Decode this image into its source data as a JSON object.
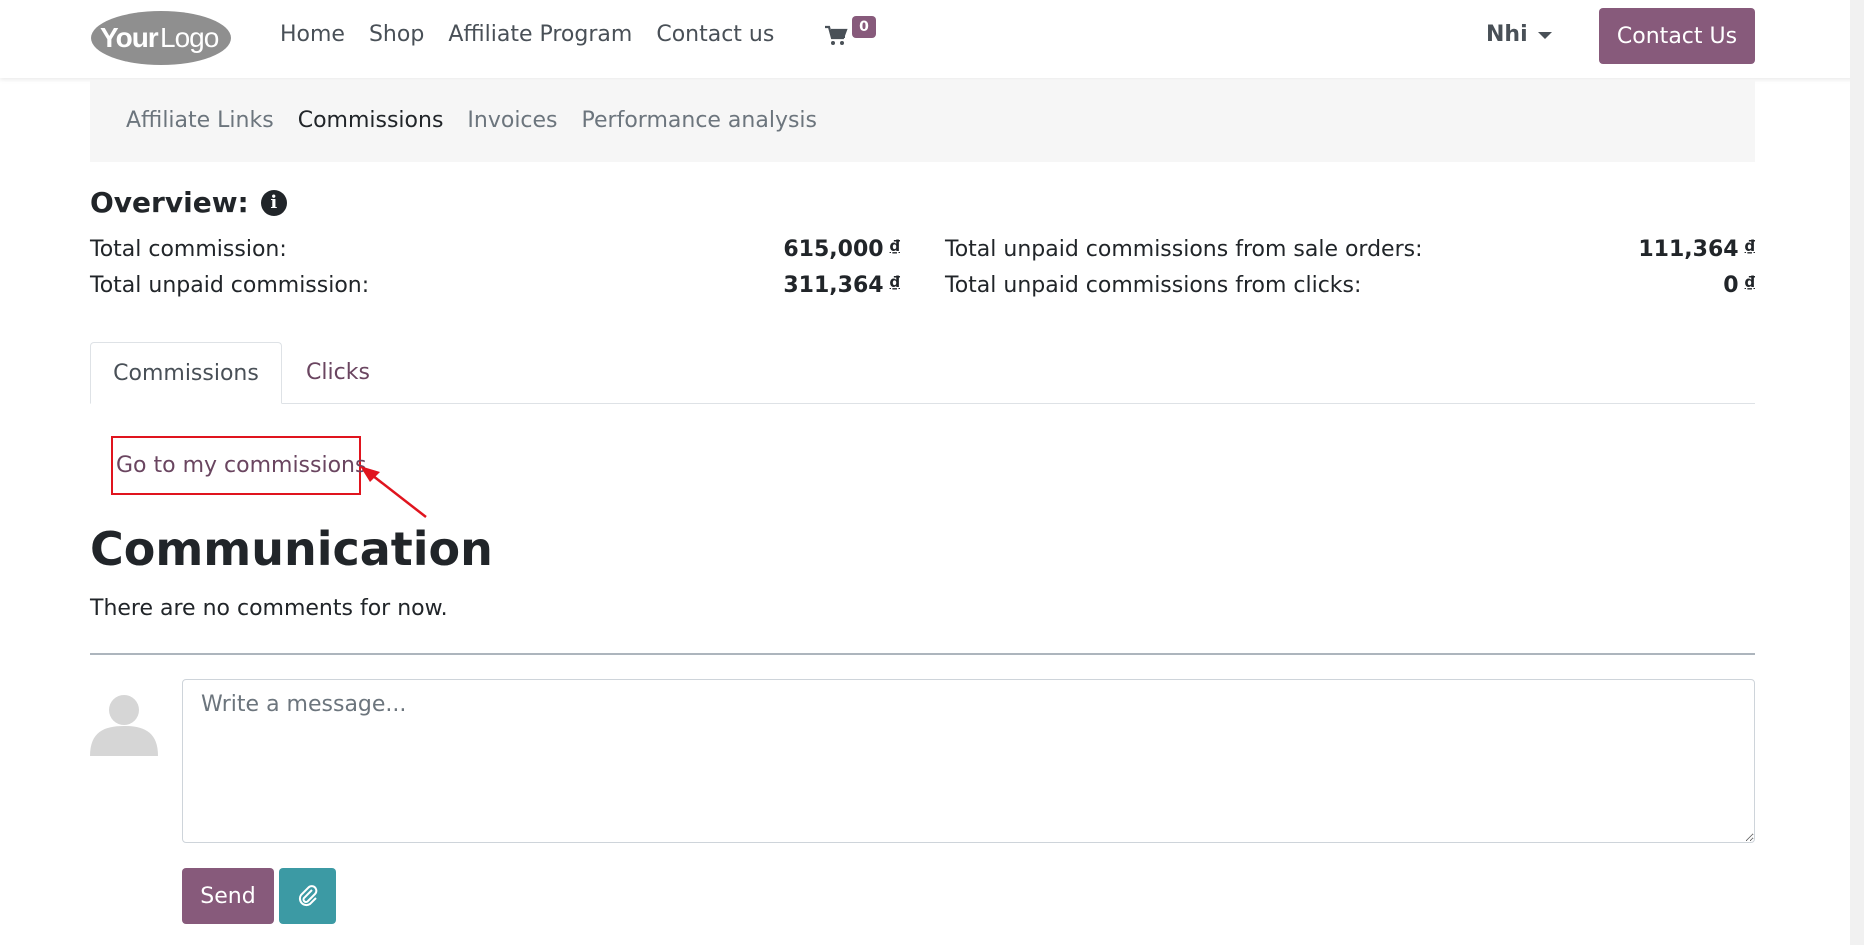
{
  "header": {
    "logo_text": "YourLogo",
    "nav": [
      "Home",
      "Shop",
      "Affiliate Program",
      "Contact us"
    ],
    "cart_count": "0",
    "user_name": "Nhi",
    "contact_button": "Contact Us"
  },
  "subnav": {
    "items": [
      "Affiliate Links",
      "Commissions",
      "Invoices",
      "Performance analysis"
    ],
    "active": "Commissions"
  },
  "overview": {
    "title": "Overview:",
    "stats": [
      {
        "label": "Total commission:",
        "value": "615,000",
        "currency": "₫"
      },
      {
        "label": "Total unpaid commission:",
        "value": "311,364",
        "currency": "₫"
      },
      {
        "label": "Total unpaid commissions from sale orders:",
        "value": "111,364",
        "currency": "₫"
      },
      {
        "label": "Total unpaid commissions from clicks:",
        "value": "0",
        "currency": "₫"
      }
    ]
  },
  "tabs": [
    "Commissions",
    "Clicks"
  ],
  "commissions_link": "Go to my commissions",
  "communication": {
    "title": "Communication",
    "empty_text": "There are no comments for now.",
    "placeholder": "Write a message...",
    "send_label": "Send"
  },
  "colors": {
    "brand": "#875a7b",
    "attach": "#3c9aa4",
    "highlight": "#e0141e"
  }
}
